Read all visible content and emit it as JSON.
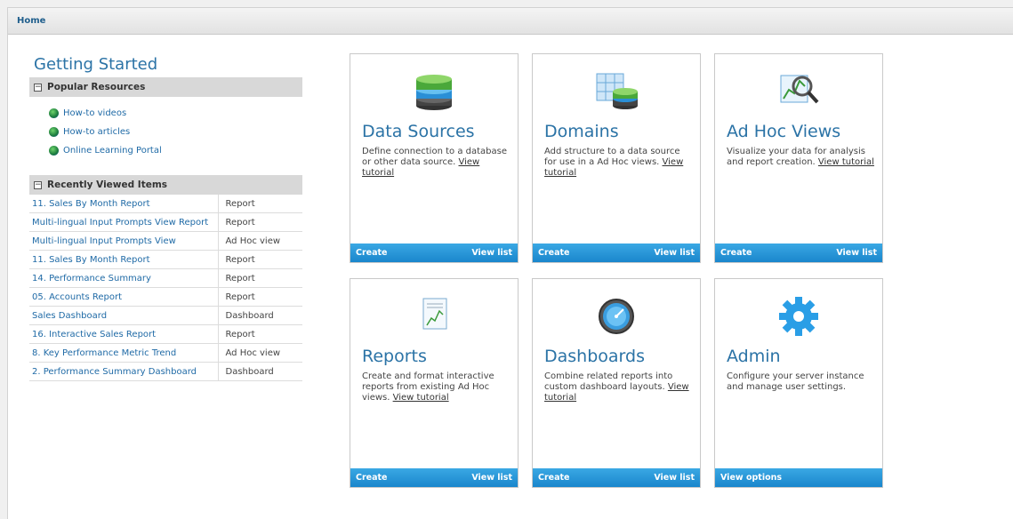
{
  "header": {
    "title": "Home"
  },
  "left": {
    "title": "Getting Started",
    "popular": {
      "label": "Popular Resources",
      "items": [
        "How-to videos",
        "How-to articles",
        "Online Learning Portal"
      ]
    },
    "recent": {
      "label": "Recently Viewed Items",
      "rows": [
        {
          "name": "11. Sales By Month Report",
          "type": "Report"
        },
        {
          "name": "Multi-lingual Input Prompts View Report",
          "type": "Report"
        },
        {
          "name": "Multi-lingual Input Prompts View",
          "type": "Ad Hoc view"
        },
        {
          "name": "11. Sales By Month Report",
          "type": "Report"
        },
        {
          "name": "14. Performance Summary",
          "type": "Report"
        },
        {
          "name": "05. Accounts Report",
          "type": "Report"
        },
        {
          "name": "Sales Dashboard",
          "type": "Dashboard"
        },
        {
          "name": "16. Interactive Sales Report",
          "type": "Report"
        },
        {
          "name": "8. Key Performance Metric Trend",
          "type": "Ad Hoc view"
        },
        {
          "name": "2. Performance Summary Dashboard",
          "type": "Dashboard"
        }
      ]
    }
  },
  "cards": [
    {
      "key": "data-sources",
      "icon": "database-icon",
      "title": "Data Sources",
      "desc": "Define connection to a database or other data source. ",
      "link": "View tutorial",
      "create": "Create",
      "view": "View list"
    },
    {
      "key": "domains",
      "icon": "domain-icon",
      "title": "Domains",
      "desc": "Add structure to a data source for use in a Ad Hoc views. ",
      "link": "View tutorial",
      "create": "Create",
      "view": "View list"
    },
    {
      "key": "ad-hoc-views",
      "icon": "chart-magnifier-icon",
      "title": "Ad Hoc Views",
      "desc": "Visualize your data for analysis and report creation. ",
      "link": "View tutorial",
      "create": "Create",
      "view": "View list"
    },
    {
      "key": "reports",
      "icon": "report-icon",
      "title": "Reports",
      "desc": "Create and format interactive reports from existing Ad Hoc views. ",
      "link": "View tutorial",
      "create": "Create",
      "view": "View list"
    },
    {
      "key": "dashboards",
      "icon": "gauge-icon",
      "title": "Dashboards",
      "desc": "Combine related reports into custom dashboard layouts. ",
      "link": "View tutorial",
      "create": "Create",
      "view": "View list"
    },
    {
      "key": "admin",
      "icon": "gear-icon",
      "title": "Admin",
      "desc": "Configure your server instance and manage user settings.",
      "link": "",
      "create": "View options",
      "view": ""
    }
  ]
}
